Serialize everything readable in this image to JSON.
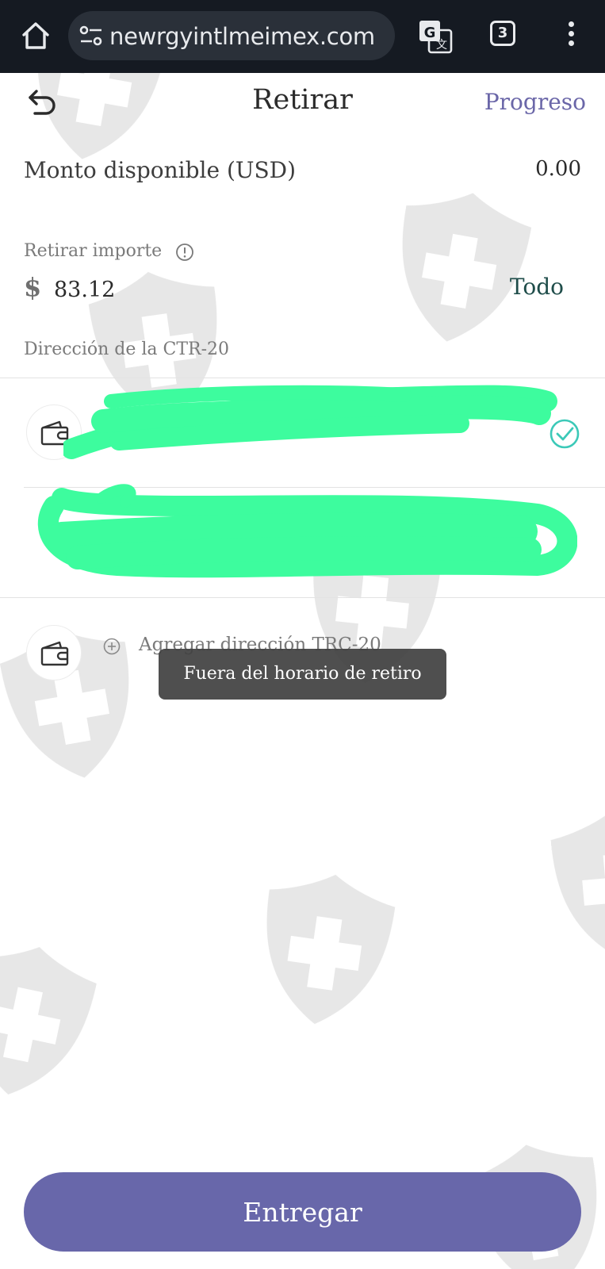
{
  "browser": {
    "url": "newrgyintlmeimex.com",
    "tab_count": "3"
  },
  "header": {
    "title": "Retirar",
    "progress_label": "Progreso"
  },
  "balance": {
    "label": "Monto disponible (USD)",
    "value": "0.00"
  },
  "withdraw": {
    "label": "Retirar importe",
    "currency_symbol": "$",
    "amount": "83.12",
    "all_label": "Todo"
  },
  "addresses": {
    "section_label": "Dirección de la CTR-20",
    "add_label": "Agregar dirección TRC-20"
  },
  "toast": {
    "message": "Fuera del horario de retiro"
  },
  "submit_label": "Entregar",
  "colors": {
    "browser_bar": "#151a22",
    "accent": "#6867aa",
    "scribble": "#3dfc9e",
    "check": "#3cc9b8"
  }
}
